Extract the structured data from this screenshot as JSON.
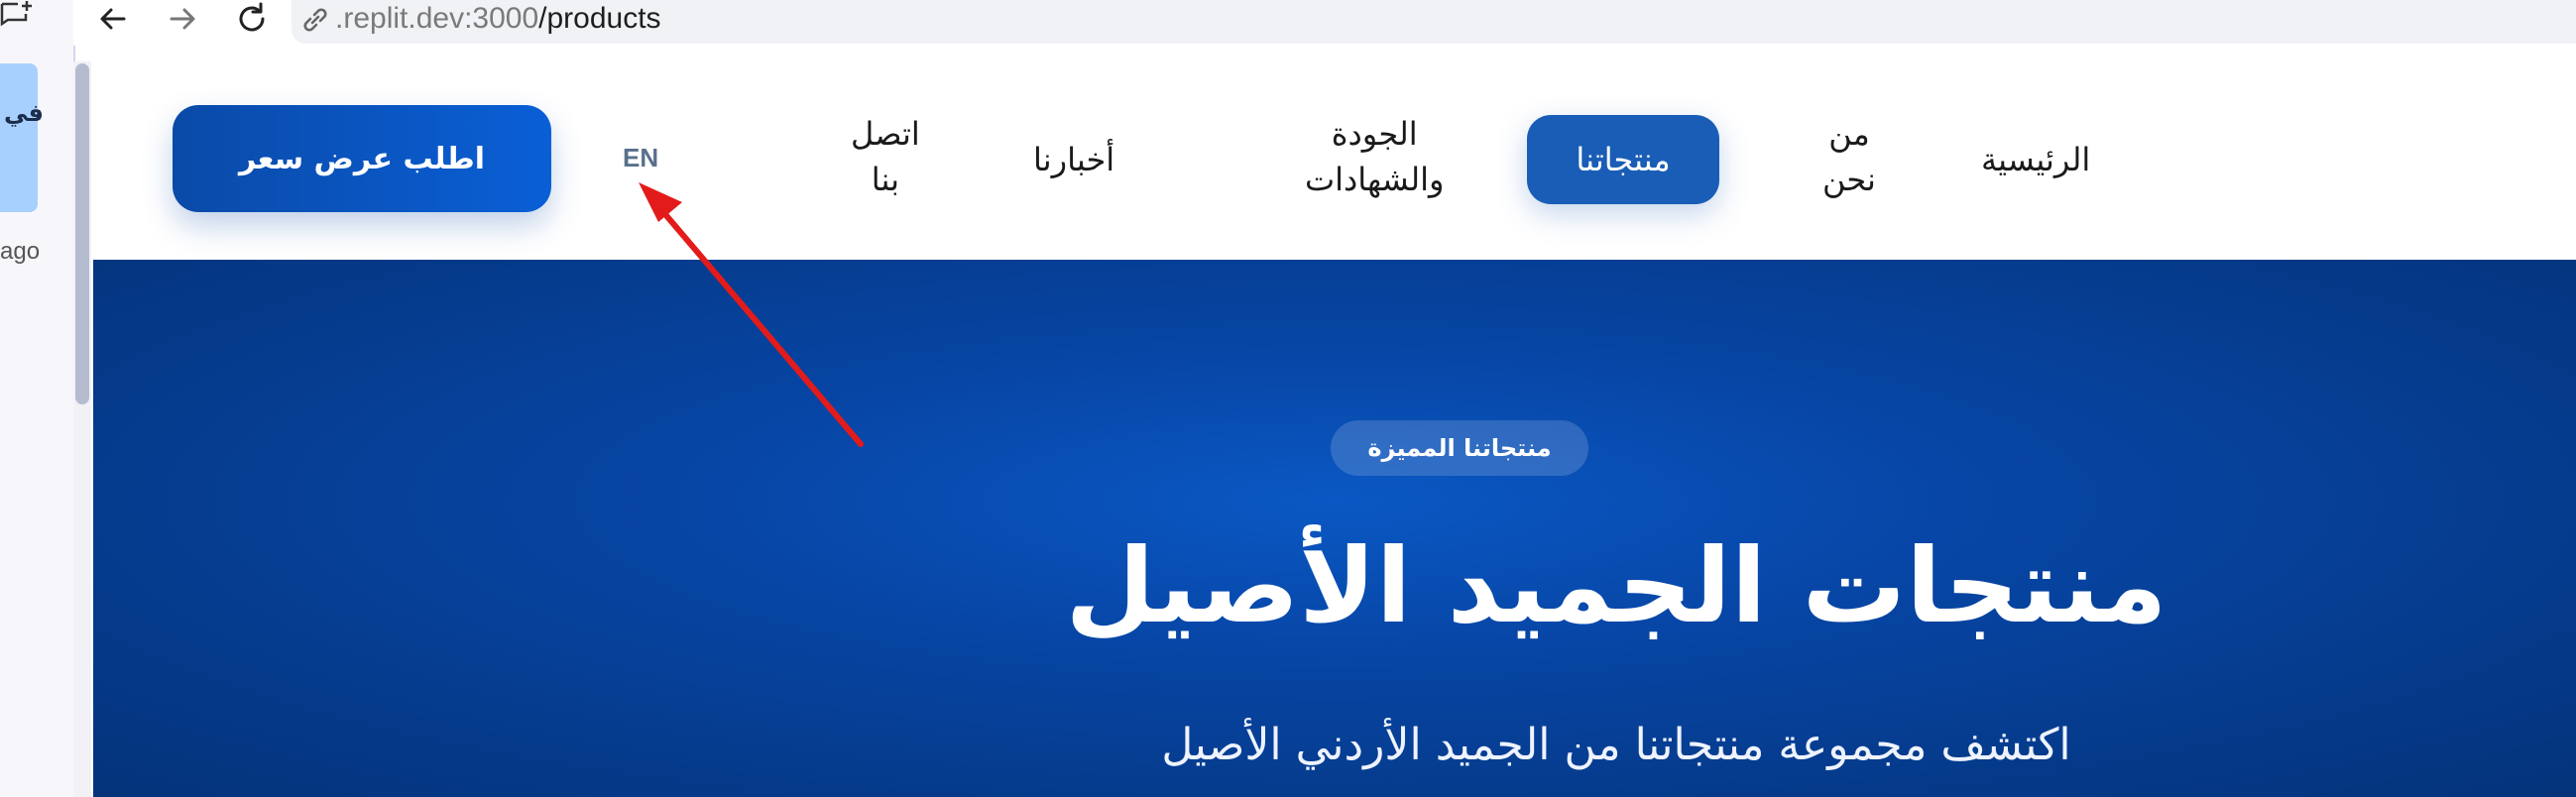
{
  "browser": {
    "url_prefix": ".replit.dev:3000",
    "url_path": "/products"
  },
  "sidebar_fragment": {
    "card_text": "في",
    "ago_text": "ago"
  },
  "header": {
    "cta_label": "اطلب عرض سعر",
    "lang_label": "EN",
    "nav": {
      "home": "الرئيسية",
      "about_line1": "من",
      "about_line2": "نحن",
      "products": "منتجاتنا",
      "quality_line1": "الجودة",
      "quality_line2": "والشهادات",
      "news": "أخبارنا",
      "contact_line1": "اتصل",
      "contact_line2": "بنا"
    }
  },
  "hero": {
    "badge": "منتجاتنا المميزة",
    "title": "منتجات الجميد الأصيل",
    "subtitle": "اكتشف مجموعة منتجاتنا من الجميد الأردني الأصيل"
  },
  "colors": {
    "primary": "#0a4aa8",
    "active_nav": "#1a5db6",
    "hero_bg": "#053a8a",
    "arrow": "#e31b1b"
  }
}
